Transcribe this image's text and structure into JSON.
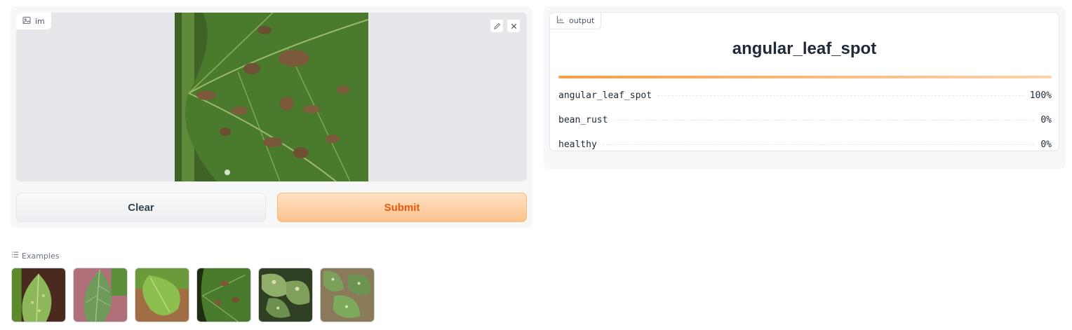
{
  "input": {
    "label": "im"
  },
  "buttons": {
    "clear_label": "Clear",
    "submit_label": "Submit"
  },
  "output": {
    "label": "output",
    "predicted_class": "angular_leaf_spot",
    "confidence_fraction": 1.0,
    "confidences": [
      {
        "label": "angular_leaf_spot",
        "value": "100%"
      },
      {
        "label": "bean_rust",
        "value": "0%"
      },
      {
        "label": "healthy",
        "value": "0%"
      }
    ]
  },
  "examples": {
    "label": "Examples",
    "count": 6
  },
  "colors": {
    "accent": "#ea580c",
    "submit_bg": "#fdc28c",
    "bar_start": "#f59e4b",
    "panel_bg": "#f6f7f9"
  }
}
